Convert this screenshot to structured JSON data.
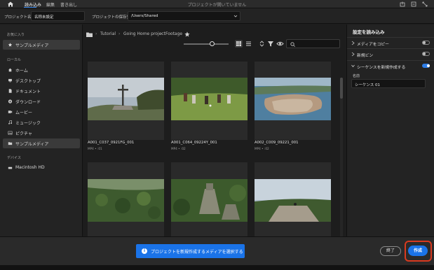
{
  "topbar": {
    "tabs": [
      "読み込み",
      "編集",
      "書き出し"
    ],
    "window_title": "プロジェクトが開いていません"
  },
  "project": {
    "name_label": "プロジェクト名",
    "name_value": "名称未設定",
    "location_label": "プロジェクトの保存先",
    "location_value": "/Users/Shared"
  },
  "sidebar": {
    "favorites_header": "お気に入り",
    "favorites": [
      {
        "label": "サンプルメディア",
        "icon": "star-icon"
      }
    ],
    "local_header": "ローカル",
    "local": [
      {
        "label": "ホーム",
        "icon": "home-icon"
      },
      {
        "label": "デスクトップ",
        "icon": "desktop-icon"
      },
      {
        "label": "ドキュメント",
        "icon": "document-icon"
      },
      {
        "label": "ダウンロード",
        "icon": "download-icon"
      },
      {
        "label": "ムービー",
        "icon": "movie-icon"
      },
      {
        "label": "ミュージック",
        "icon": "music-icon"
      },
      {
        "label": "ピクチャ",
        "icon": "picture-icon"
      },
      {
        "label": "サンプルメディア",
        "icon": "folder-icon"
      }
    ],
    "devices_header": "デバイス",
    "devices": [
      {
        "label": "Macintosh HD",
        "icon": "disk-icon"
      }
    ]
  },
  "breadcrumb": [
    "Tutorial",
    "Going Home project",
    "Footage"
  ],
  "clips": [
    {
      "name": "A001_C037_0921FG_001",
      "meta": "MP4 • :01"
    },
    {
      "name": "A001_C064_09224Y_001",
      "meta": "MP4 • :02"
    },
    {
      "name": "A002_C009_09221_001",
      "meta": "MP4 • :02"
    }
  ],
  "import_settings": {
    "title": "設定を読み込み",
    "copy_media": {
      "label": "メディアをコピー",
      "on": false
    },
    "new_bin": {
      "label": "新規ビン",
      "on": false
    },
    "new_sequence": {
      "label": "シーケンスを新規作成する",
      "on": true
    },
    "name_label": "名前",
    "name_value": "シーケンス 01"
  },
  "bottom": {
    "info_text": "プロジェクトを新規作成するメディアを選択する",
    "exit_label": "終了",
    "create_label": "作成"
  },
  "colors": {
    "accent": "#1a73e8",
    "highlight": "#d83a1f"
  }
}
